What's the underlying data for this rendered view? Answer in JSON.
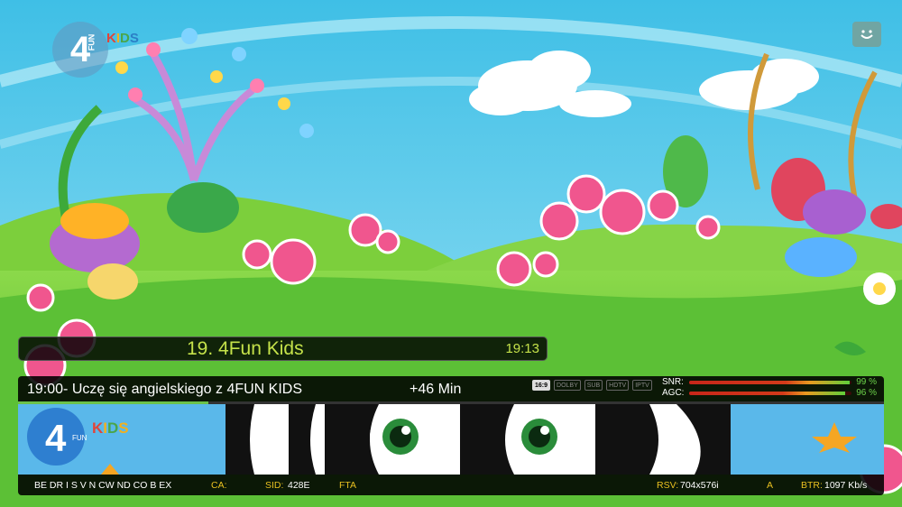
{
  "overlay": {
    "channel_logo": {
      "text": "4",
      "sub": "FUN",
      "kids": [
        "K",
        "I",
        "D",
        "S"
      ]
    },
    "smiley_icon": "smiley-icon"
  },
  "channel_bar": {
    "name": "19. 4Fun Kids",
    "time": "19:13"
  },
  "program": {
    "title": "19:00- Uczę się angielskiego z 4FUN KIDS",
    "remaining": "+46 Min",
    "progress_percent": 22
  },
  "badges": [
    {
      "text": "16:9",
      "active": true
    },
    {
      "text": "DOLBY",
      "active": false
    },
    {
      "text": "SUB",
      "active": false
    },
    {
      "text": "HDTV",
      "active": false
    },
    {
      "text": "IPTV",
      "active": false
    }
  ],
  "signal": {
    "snr_label": "SNR:",
    "snr_value": "99 %",
    "snr_percent": 99,
    "agc_label": "AGC:",
    "agc_value": "96 %",
    "agc_percent": 96
  },
  "status": {
    "systems": "BE DR I S V N CW ND CO B EX",
    "ca_label": "CA:",
    "sid_label": "SID:",
    "sid_value": "428E",
    "fta": "FTA",
    "rsv_label": "RSV:",
    "rsv_value": "704x576i",
    "audio": "A",
    "btr_label": "BTR:",
    "btr_value": "1097 Kb/s"
  },
  "preview": {
    "logo_text": "4",
    "logo_sub": "FUN",
    "kids": [
      "K",
      "I",
      "D",
      "S"
    ]
  },
  "colors": {
    "accent_green": "#c5e24a",
    "signal_green": "#6cd24a",
    "status_yellow": "#e8c020"
  }
}
